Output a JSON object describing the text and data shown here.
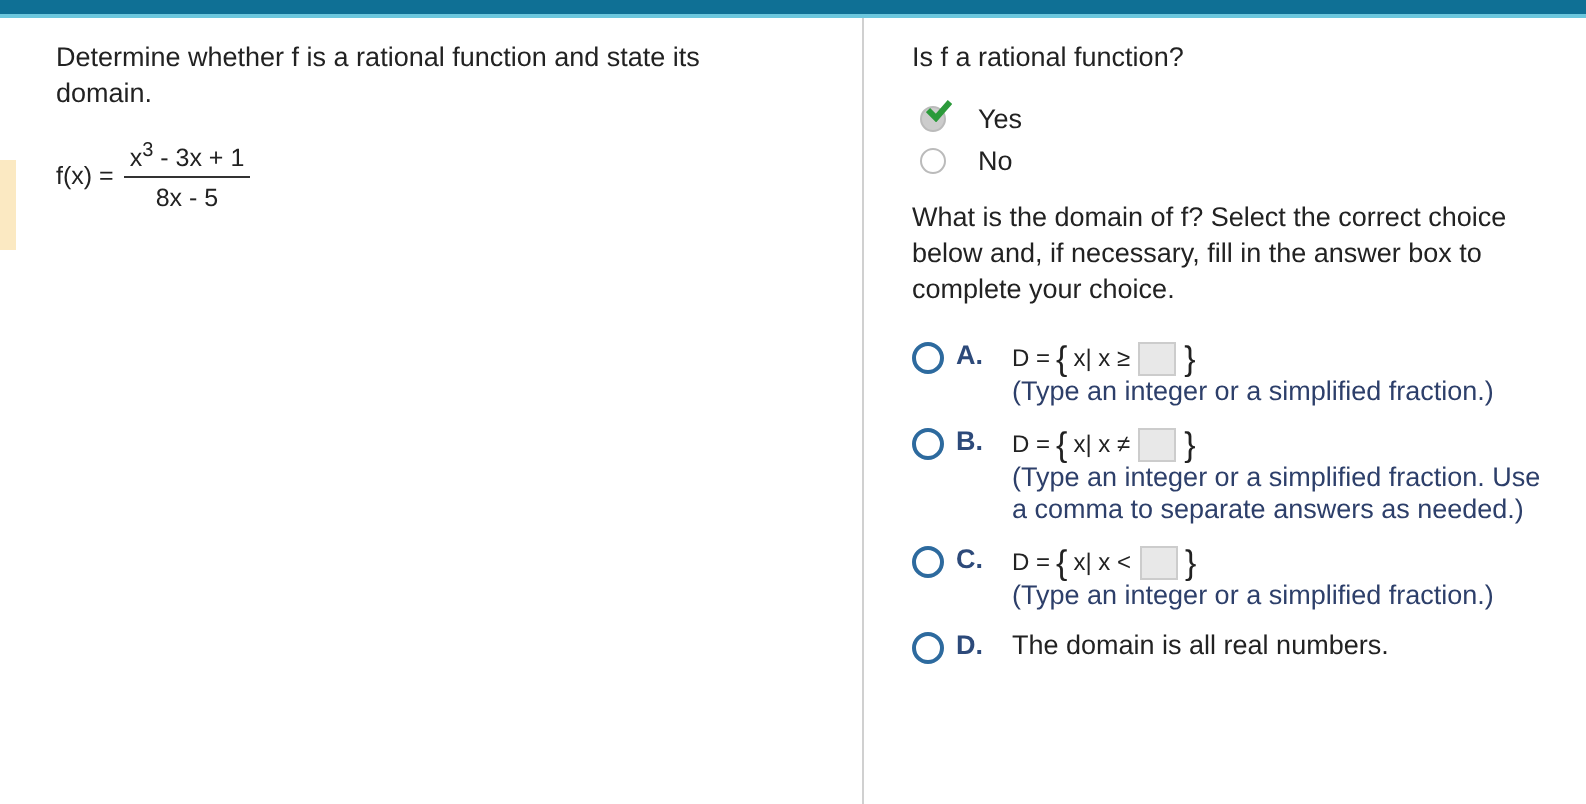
{
  "problem": {
    "prompt": "Determine whether f is a rational function and state its domain.",
    "function_label": "f(x) =",
    "numerator": "x$^{3}$ - 3x + 1",
    "denominator": "8x - 5"
  },
  "question_1": {
    "prompt": "Is f a rational function?",
    "options": [
      {
        "label": "Yes",
        "selected": true
      },
      {
        "label": "No",
        "selected": false
      }
    ]
  },
  "question_2": {
    "prompt": "What is the domain of f? Select the correct choice below and, if necessary, fill in the answer box to complete your choice.",
    "choices": [
      {
        "letter": "A.",
        "kind": "set",
        "set_prefix": "D =",
        "set_open": "{",
        "relation": "x| x ≥",
        "set_close": "}",
        "note": "(Type an integer or a simplified fraction.)",
        "selected": false
      },
      {
        "letter": "B.",
        "kind": "set",
        "set_prefix": "D =",
        "set_open": "{",
        "relation": "x| x ≠",
        "set_close": "}",
        "note": "(Type an integer or a simplified fraction. Use a comma to separate answers as needed.)",
        "selected": false
      },
      {
        "letter": "C.",
        "kind": "set",
        "set_prefix": "D =",
        "set_open": "{",
        "relation": "x| x <",
        "set_close": "}",
        "note": "(Type an integer or a simplified fraction.)",
        "selected": false
      },
      {
        "letter": "D.",
        "kind": "text",
        "text": "The domain is all real numbers.",
        "selected": false
      }
    ]
  }
}
